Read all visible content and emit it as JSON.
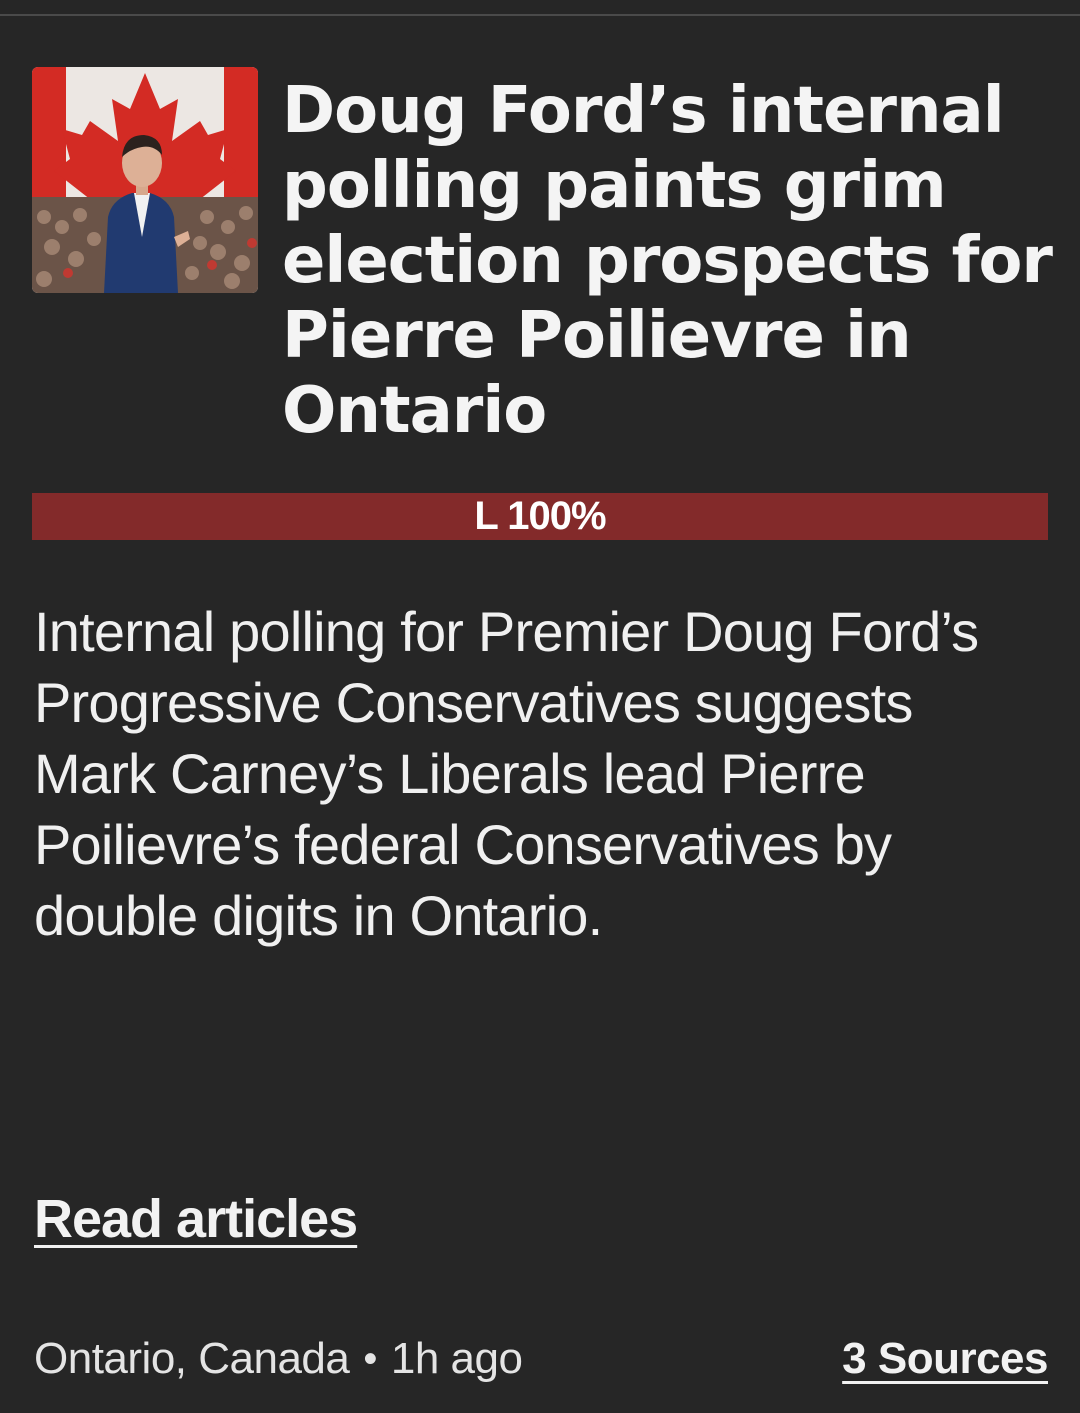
{
  "article": {
    "image_description": "photo-thumbnail",
    "headline": "Doug Ford’s internal polling paints grim election prospects for Pierre Poilievre in Ontario",
    "bias": {
      "label": "L 100%",
      "left_percent": 100,
      "color": "#832a2a"
    },
    "summary": "Internal polling for Premier Doug Ford’s Progressive Conservatives suggests Mark Carney’s Liberals lead Pierre Poilievre’s federal Conservatives by double digits in Ontario.",
    "read_link": "Read articles",
    "location": "Ontario, Canada",
    "separator": "•",
    "time_ago": "1h ago",
    "sources": "3 Sources"
  },
  "colors": {
    "background": "#262626",
    "text": "#f2f2f2",
    "bias_bar": "#832a2a"
  }
}
